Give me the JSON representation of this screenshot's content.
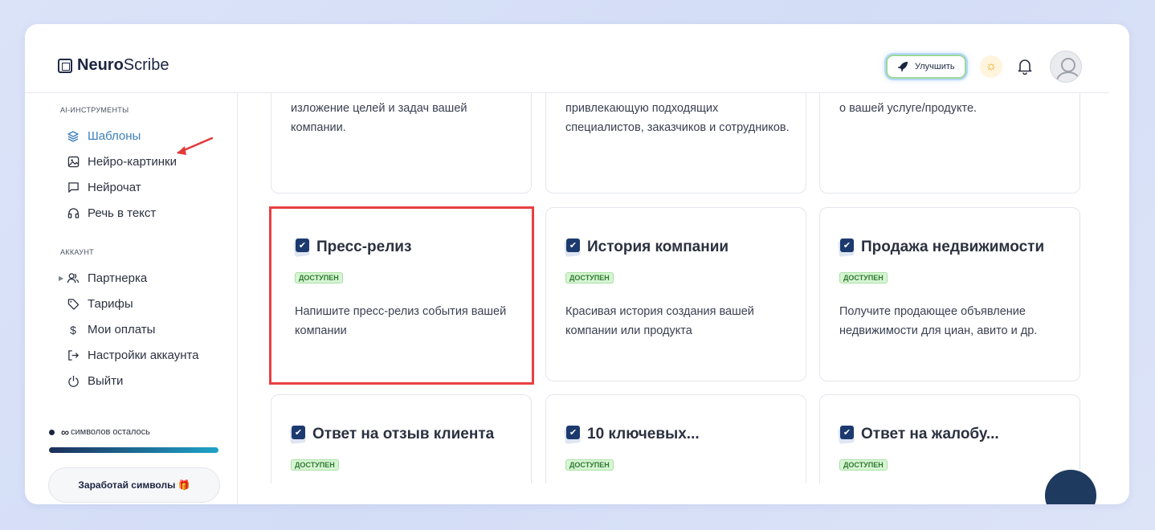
{
  "header": {
    "logo_bold": "Neuro",
    "logo_light": "Scribe",
    "upgrade_label": "Улучшить"
  },
  "sidebar": {
    "section_ai": "AI-ИНСТРУМЕНТЫ",
    "ai_items": [
      {
        "label": "Шаблоны",
        "icon": "layers-icon",
        "active": true
      },
      {
        "label": "Нейро-картинки",
        "icon": "image-icon"
      },
      {
        "label": "Нейрочат",
        "icon": "chat-icon"
      },
      {
        "label": "Речь в текст",
        "icon": "headphones-icon"
      }
    ],
    "section_account": "АККАУНТ",
    "account_items": [
      {
        "label": "Партнерка",
        "icon": "users-icon"
      },
      {
        "label": "Тарифы",
        "icon": "tag-icon"
      },
      {
        "label": "Мои оплаты",
        "icon": "dollar-icon"
      },
      {
        "label": "Настройки аккаунта",
        "icon": "logout-arrow-icon"
      },
      {
        "label": "Выйти",
        "icon": "power-icon"
      }
    ],
    "symbols_infinity": "∞",
    "symbols_text": "символов осталось",
    "earn_label": "Заработай символы 🎁"
  },
  "cards_top": [
    {
      "desc": "изложение целей и задач вашей компании."
    },
    {
      "desc": "привлекающую подходящих специалистов, заказчиков и сотрудников."
    },
    {
      "desc": "о вашей услуге/продукте."
    }
  ],
  "cards": [
    {
      "title": "Пресс-релиз",
      "badge": "доступен",
      "desc": "Напишите пресс-релиз события вашей компании"
    },
    {
      "title": "История компании",
      "badge": "доступен",
      "desc": "Красивая история создания вашей компании или продукта"
    },
    {
      "title": "Продажа недвижимости",
      "badge": "доступен",
      "desc": "Получите продающее объявление недвижимости для циан, авито и др."
    },
    {
      "title": "Ответ на отзыв клиента",
      "badge": "доступен"
    },
    {
      "title": "10 ключевых...",
      "badge": "доступен"
    },
    {
      "title": "Ответ на жалобу...",
      "badge": "доступен"
    }
  ]
}
